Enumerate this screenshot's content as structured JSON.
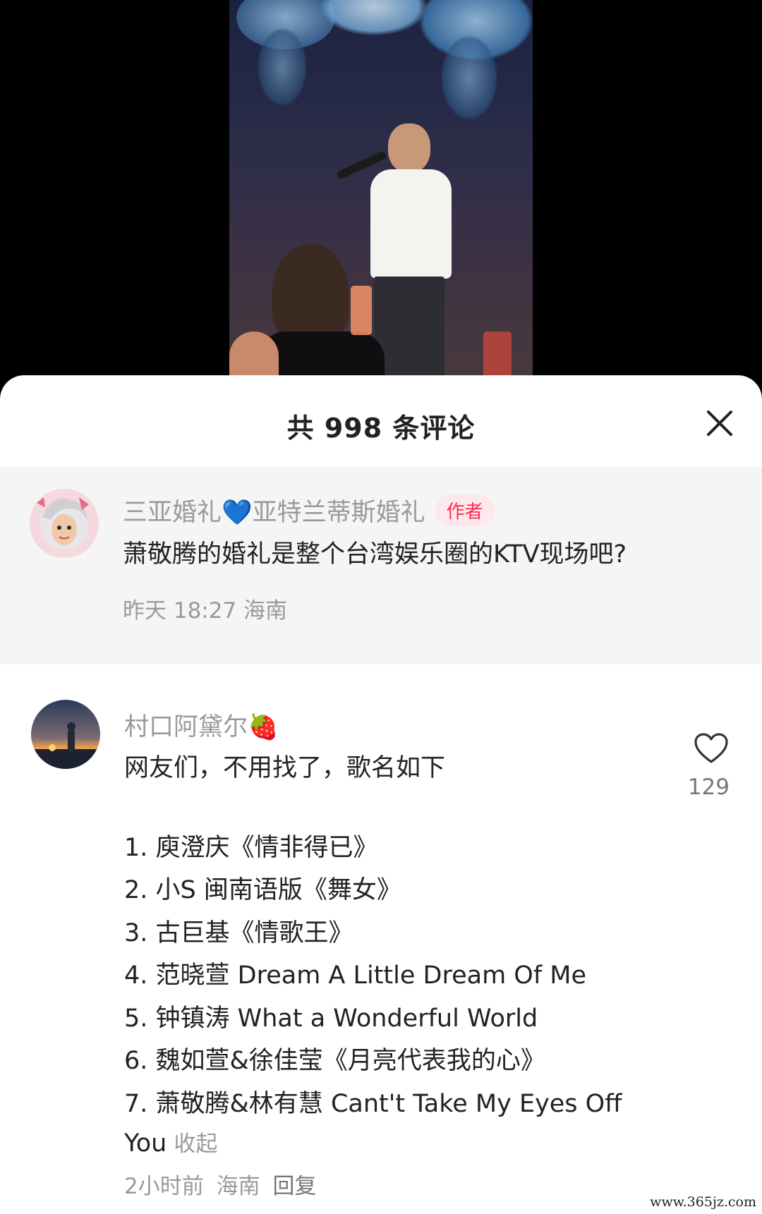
{
  "header": {
    "title": "共 998 条评论"
  },
  "author_comment": {
    "username": "三亚婚礼💙亚特兰蒂斯婚礼",
    "badge": "作者",
    "text": "萧敬腾的婚礼是整个台湾娱乐圈的KTV现场吧?",
    "meta": "昨天 18:27 海南"
  },
  "comment2": {
    "username": "村口阿黛尔🍓",
    "intro": "网友们，不用找了，歌名如下",
    "songs": [
      "1. 庾澄庆《情非得已》",
      "2. 小S 闽南语版《舞女》",
      "3. 古巨基《情歌王》",
      "4. 范晓萱 Dream A Little Dream Of Me",
      "5. 钟镇涛 What a Wonderful World",
      "6. 魏如萱&徐佳莹《月亮代表我的心》",
      "7. 萧敬腾&林有慧 Cant't Take My Eyes Off",
      "You"
    ],
    "collapse_label": "收起",
    "time": "2小时前",
    "location": "海南",
    "reply_label": "回复",
    "likes": "129"
  },
  "icons": {
    "close": "close-icon",
    "like": "heart-outline-icon"
  },
  "watermark": "www.365jz.com",
  "colors": {
    "badge_text": "#ff2c55",
    "badge_bg": "#fde8ec",
    "meta_gray": "#9a9a9a",
    "author_bg": "#f5f5f5"
  }
}
